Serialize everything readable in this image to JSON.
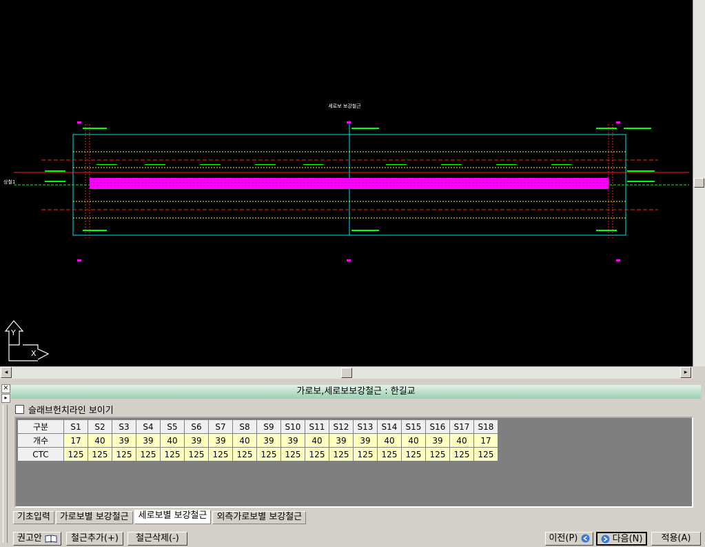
{
  "drawing": {
    "title": "세로보 보강철근",
    "side_label": "상철1"
  },
  "panel": {
    "title": "가로보,세로보보강철근 : 한길교",
    "checkbox_label": "슬래브헌치라인 보이기",
    "close_glyph": "×",
    "pin_glyph": "▸"
  },
  "grid": {
    "corner_label": "구분",
    "columns": [
      "S1",
      "S2",
      "S3",
      "S4",
      "S5",
      "S6",
      "S7",
      "S8",
      "S9",
      "S10",
      "S11",
      "S12",
      "S13",
      "S14",
      "S15",
      "S16",
      "S17",
      "S18"
    ],
    "rows": [
      {
        "label": "개수",
        "values": [
          "17",
          "40",
          "39",
          "39",
          "40",
          "39",
          "39",
          "40",
          "39",
          "39",
          "40",
          "39",
          "39",
          "40",
          "40",
          "39",
          "40",
          "17"
        ]
      },
      {
        "label": "CTC",
        "values": [
          "125",
          "125",
          "125",
          "125",
          "125",
          "125",
          "125",
          "125",
          "125",
          "125",
          "125",
          "125",
          "125",
          "125",
          "125",
          "125",
          "125",
          "125"
        ]
      }
    ]
  },
  "tabs": [
    {
      "label": "기초입력"
    },
    {
      "label": "가로보별 보강철근"
    },
    {
      "label": "세로보별 보강철근"
    },
    {
      "label": "외측가로보별 보강철근"
    }
  ],
  "buttons": {
    "recommend": "권고안",
    "add_rebar": "철근추가(+)",
    "delete_rebar": "철근삭제(-)",
    "prev": "이전(P)",
    "next": "다음(N)",
    "apply": "적용(A)"
  },
  "scroll": {
    "left": "◂",
    "right": "▸"
  },
  "ucs": {
    "x": "X",
    "y": "Y"
  },
  "colors": {
    "cad_bg": "#000000",
    "cyan": "#00e5ee",
    "magenta": "#ff00ff",
    "green": "#00ff00",
    "red": "#ff2020",
    "yellow": "#ffff00",
    "grid_value_bg": "#ffffc0",
    "panel_title_green": "#9ccfb1"
  }
}
